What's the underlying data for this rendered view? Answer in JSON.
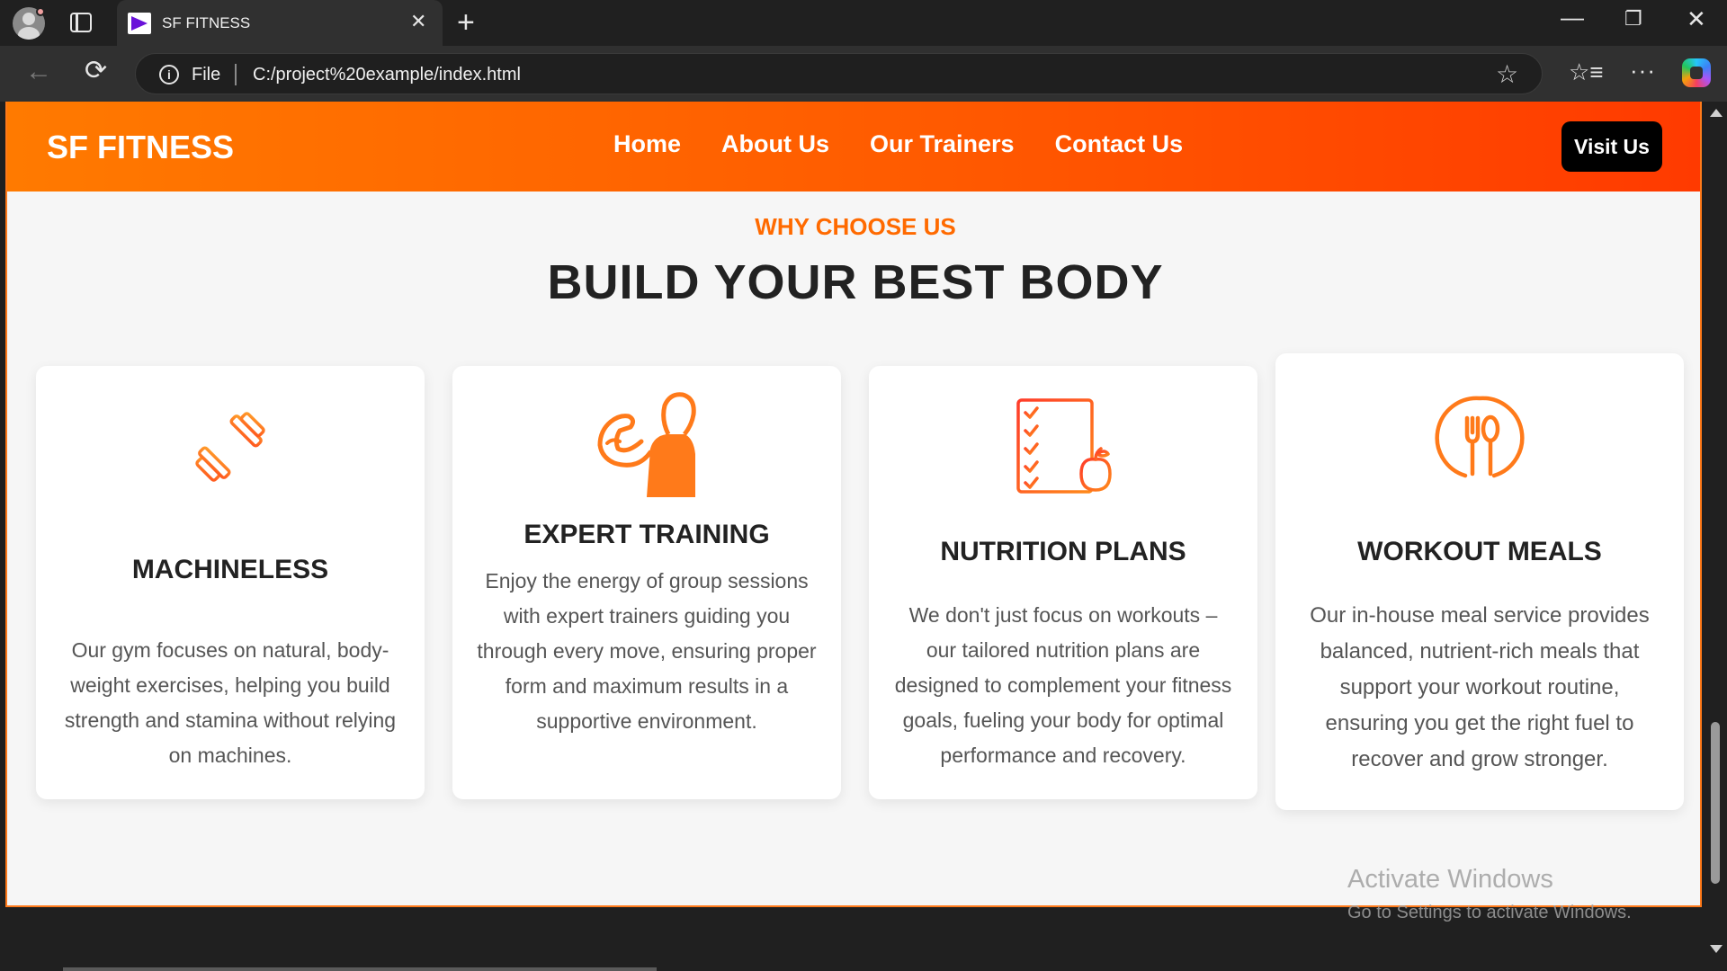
{
  "browser": {
    "tab_title": "SF FITNESS",
    "close_tab": "✕",
    "new_tab": "+",
    "minimize": "—",
    "maximize": "❐",
    "close": "✕",
    "back": "←",
    "reload": "⟳",
    "info": "i",
    "address_scheme": "File",
    "address_url": "C:/project%20example/index.html",
    "favorite": "☆",
    "favorites_bar": "☆≡",
    "more": "···"
  },
  "site": {
    "logo": "SF FITNESS",
    "nav": [
      "Home",
      "About Us",
      "Our Trainers",
      "Contact Us"
    ],
    "cta": "Visit Us",
    "colors": {
      "accent": "#ff6a00",
      "header_start": "#ff7a00",
      "header_end": "#ff3a00",
      "button": "#000000"
    }
  },
  "section": {
    "kicker": "WHY CHOOSE US",
    "title": "BUILD YOUR BEST BODY",
    "cards": [
      {
        "icon": "dumbbell-icon",
        "title": "MACHINELESS",
        "text": "Our gym focuses on natural, body-weight exercises, helping you build strength and stamina without relying on machines."
      },
      {
        "icon": "trainer-flex-icon",
        "title": "EXPERT TRAINING",
        "text": "Enjoy the energy of group sessions with expert trainers guiding you through every move, ensuring proper form and maximum results in a supportive environment."
      },
      {
        "icon": "nutrition-checklist-icon",
        "title": "NUTRITION PLANS",
        "text": "We don't just focus on workouts – our tailored nutrition plans are designed to complement your fitness goals, fueling your body for optimal performance and recovery."
      },
      {
        "icon": "fork-spoon-icon",
        "title": "WORKOUT MEALS",
        "text": "Our in-house meal service provides balanced, nutrient-rich meals that support your workout routine, ensuring you get the right fuel to recover and grow stronger."
      }
    ]
  },
  "os": {
    "watermark_title": "Activate Windows",
    "watermark_sub": "Go to Settings to activate Windows."
  }
}
